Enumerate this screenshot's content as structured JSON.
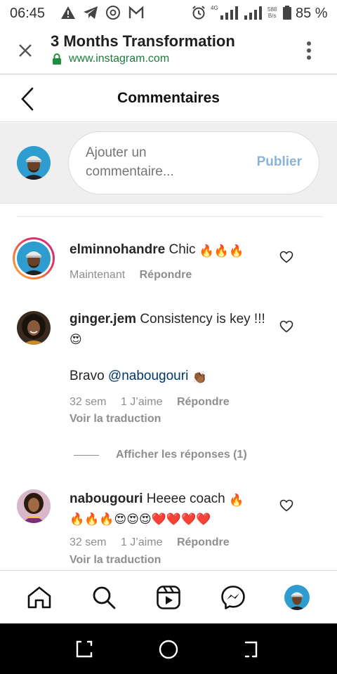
{
  "status_bar": {
    "time": "06:45",
    "net_speed_top": "588",
    "net_speed_bottom": "B/s",
    "network_type": "4G",
    "battery": "85 %"
  },
  "browser": {
    "title": "3 Months Transformation",
    "url": "www.instagram.com"
  },
  "header": {
    "title": "Commentaires"
  },
  "composer": {
    "placeholder": "Ajouter un commentaire...",
    "publish_label": "Publier"
  },
  "comments": [
    {
      "username": "elminnohandre",
      "text": "Chic",
      "emojis": "🔥🔥🔥",
      "time": "Maintenant",
      "reply_label": "Répondre"
    },
    {
      "username": "ginger.jem",
      "text": "Consistency is key !!!",
      "emoji_after_text": "😍",
      "second_line_prefix": "Bravo",
      "mention": "@nabougouri",
      "emoji_after_mention": "👏🏾",
      "time": "32 sem",
      "likes": "1 J’aime",
      "reply_label": "Répondre",
      "translate_label": "Voir la traduction",
      "replies_label": "Afficher les réponses (1)"
    },
    {
      "username": "nabougouri",
      "text": "Heeee coach",
      "emojis_line1": "🔥",
      "emojis_line2": "🔥🔥🔥😍😍😍❤️❤️❤️❤️",
      "time": "32 sem",
      "likes": "1 J’aime",
      "reply_label": "Répondre",
      "translate_label": "Voir la traduction"
    }
  ],
  "colors": {
    "fire": "#f4511e",
    "heart": "#e53935",
    "link": "#00376b",
    "publish": "#8ab4d8",
    "url_green": "#1b7c3a",
    "story_ring_start": "#fcaf45",
    "story_ring_end": "#c13584"
  },
  "bottom_nav": [
    "home-icon",
    "search-icon",
    "reels-icon",
    "messenger-icon",
    "profile-avatar"
  ]
}
